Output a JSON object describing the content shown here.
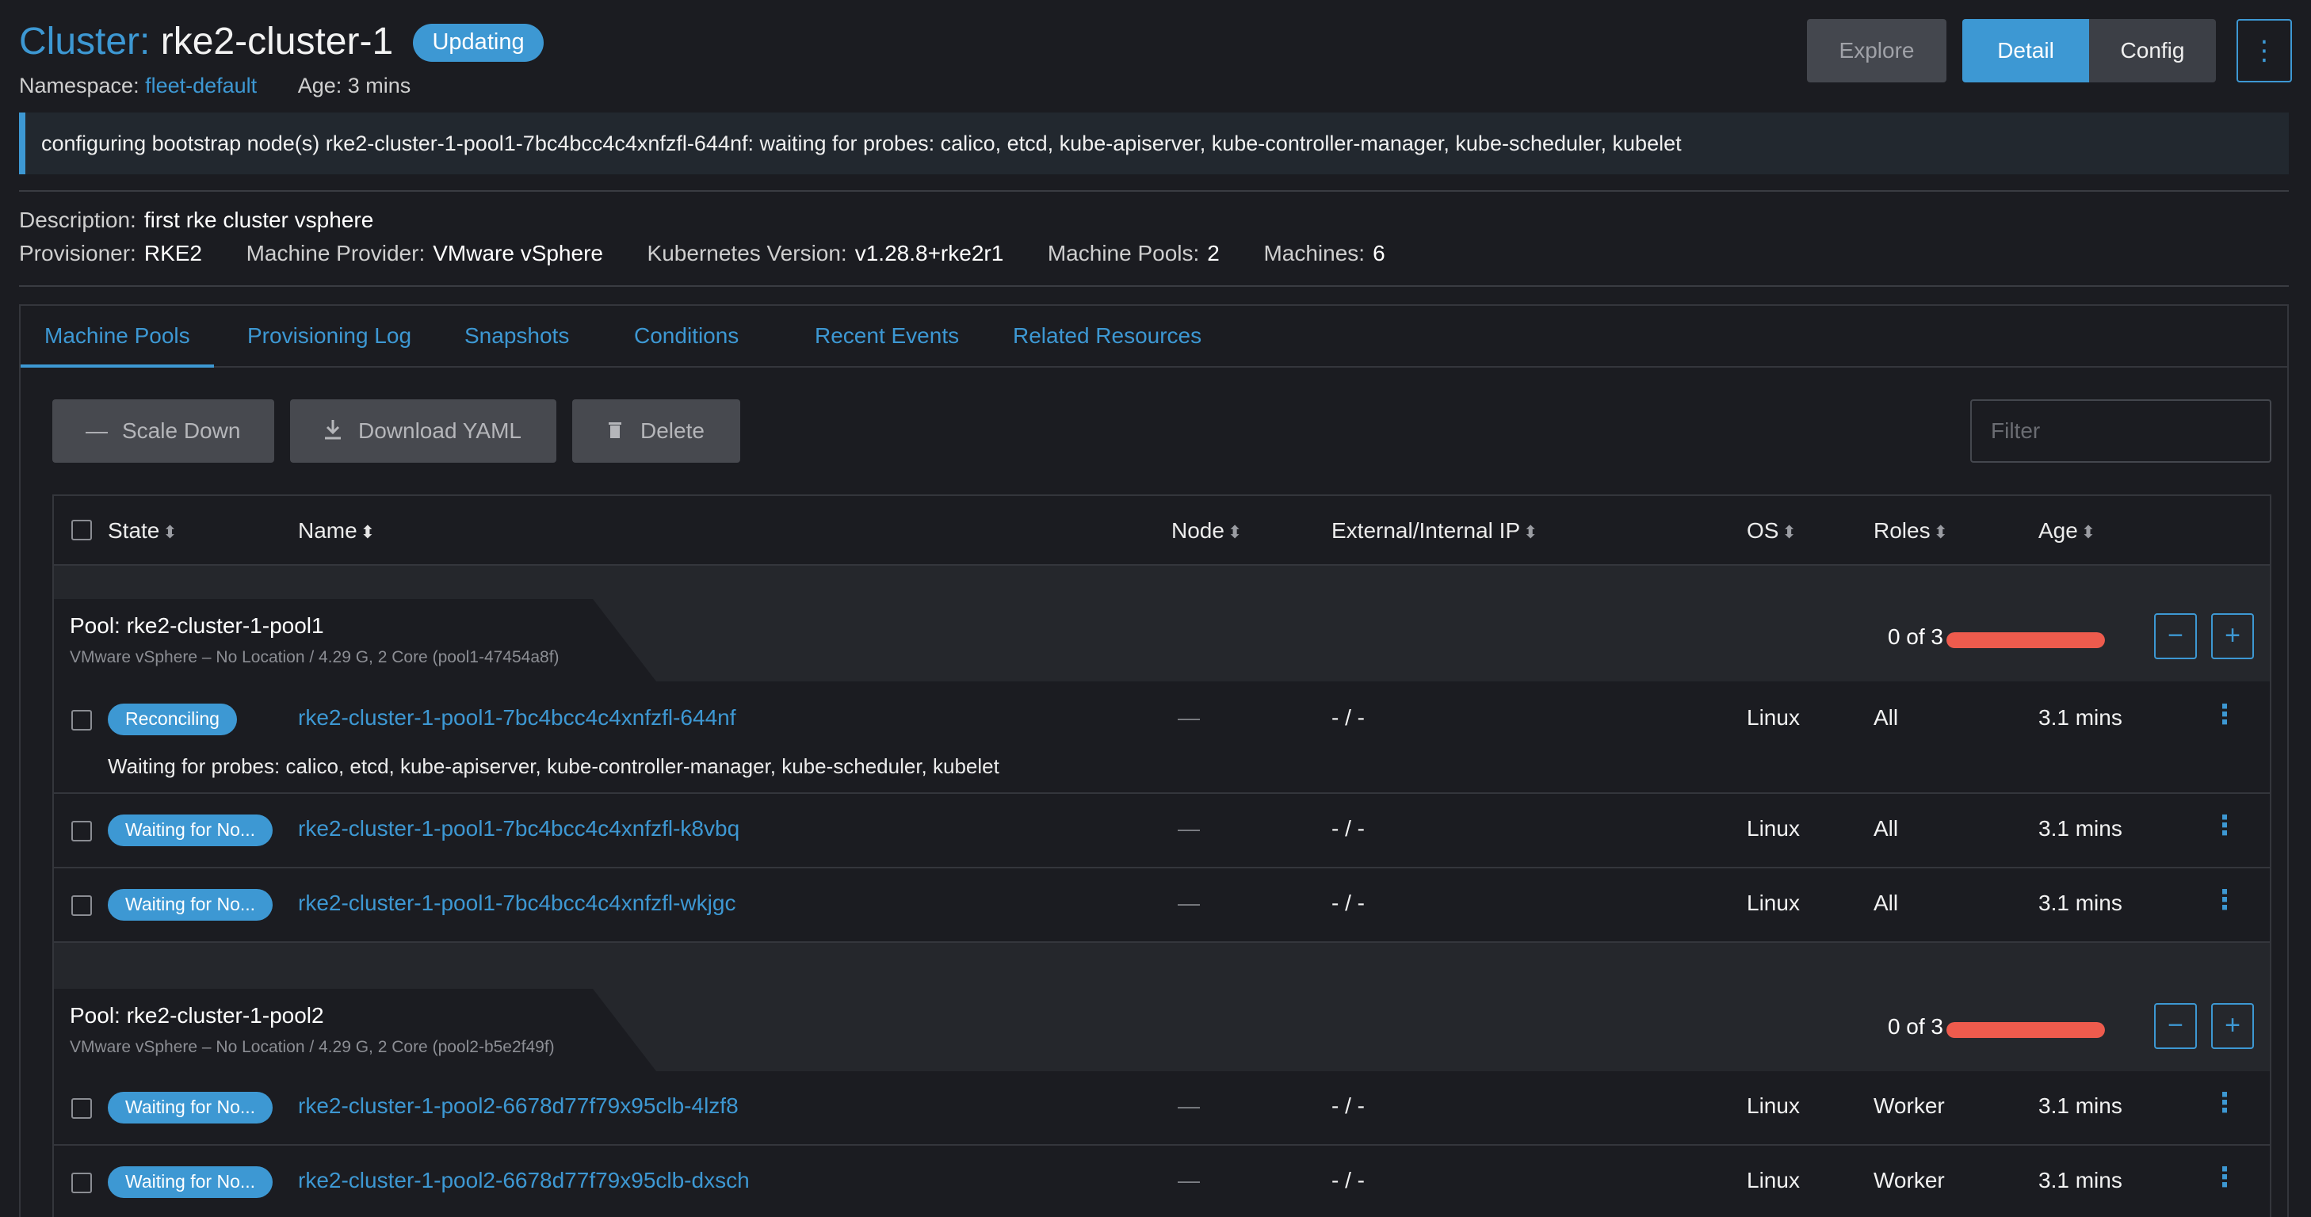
{
  "header": {
    "title_prefix": "Cluster:",
    "title_name": "rke2-cluster-1",
    "status_badge": "Updating",
    "namespace_label": "Namespace:",
    "namespace_value": "fleet-default",
    "age_label": "Age:",
    "age_value": "3 mins",
    "buttons": {
      "explore": "Explore",
      "detail": "Detail",
      "config": "Config",
      "more": "⋮"
    }
  },
  "banner": {
    "message": "configuring bootstrap node(s) rke2-cluster-1-pool1-7bc4bcc4c4xnfzfl-644nf: waiting for probes: calico, etcd, kube-apiserver, kube-controller-manager, kube-scheduler, kubelet"
  },
  "info": {
    "description_label": "Description:",
    "description_value": "first rke cluster vsphere",
    "provisioner_label": "Provisioner:",
    "provisioner_value": "RKE2",
    "machine_provider_label": "Machine Provider:",
    "machine_provider_value": "VMware vSphere",
    "k8s_version_label": "Kubernetes Version:",
    "k8s_version_value": "v1.28.8+rke2r1",
    "machine_pools_label": "Machine Pools:",
    "machine_pools_value": "2",
    "machines_label": "Machines:",
    "machines_value": "6"
  },
  "tabs": [
    "Machine Pools",
    "Provisioning Log",
    "Snapshots",
    "Conditions",
    "Recent Events",
    "Related Resources"
  ],
  "actions": {
    "scale_down": "Scale Down",
    "download_yaml": "Download YAML",
    "delete": "Delete",
    "filter_placeholder": "Filter"
  },
  "table": {
    "columns": {
      "state": "State",
      "name": "Name",
      "node": "Node",
      "ip": "External/Internal IP",
      "os": "OS",
      "roles": "Roles",
      "age": "Age"
    },
    "groups": [
      {
        "title": "Pool: rke2-cluster-1-pool1",
        "subtitle": "VMware vSphere – No Location / 4.29 G, 2 Core (pool1-47454a8f)",
        "count_text": "0 of 3",
        "progress_fraction": 0,
        "rows": [
          {
            "state": "Reconciling",
            "name": "rke2-cluster-1-pool1-7bc4bcc4c4xnfzfl-644nf",
            "node": "—",
            "ip": "- / -",
            "os": "Linux",
            "roles": "All",
            "age": "3.1 mins",
            "message": "Waiting for probes: calico, etcd, kube-apiserver, kube-controller-manager, kube-scheduler, kubelet"
          },
          {
            "state": "Waiting for No...",
            "name": "rke2-cluster-1-pool1-7bc4bcc4c4xnfzfl-k8vbq",
            "node": "—",
            "ip": "- / -",
            "os": "Linux",
            "roles": "All",
            "age": "3.1 mins"
          },
          {
            "state": "Waiting for No...",
            "name": "rke2-cluster-1-pool1-7bc4bcc4c4xnfzfl-wkjgc",
            "node": "—",
            "ip": "- / -",
            "os": "Linux",
            "roles": "All",
            "age": "3.1 mins"
          }
        ]
      },
      {
        "title": "Pool: rke2-cluster-1-pool2",
        "subtitle": "VMware vSphere – No Location / 4.29 G, 2 Core (pool2-b5e2f49f)",
        "count_text": "0 of 3",
        "progress_fraction": 0,
        "rows": [
          {
            "state": "Waiting for No...",
            "name": "rke2-cluster-1-pool2-6678d77f79x95clb-4lzf8",
            "node": "—",
            "ip": "- / -",
            "os": "Linux",
            "roles": "Worker",
            "age": "3.1 mins"
          },
          {
            "state": "Waiting for No...",
            "name": "rke2-cluster-1-pool2-6678d77f79x95clb-dxsch",
            "node": "—",
            "ip": "- / -",
            "os": "Linux",
            "roles": "Worker",
            "age": "3.1 mins"
          }
        ]
      }
    ]
  },
  "icons": {
    "sort": "sort-icon",
    "minus": "minus-icon",
    "download": "download-icon",
    "trash": "trash-icon",
    "kebab": "kebab-icon",
    "plus": "plus-icon"
  },
  "colors": {
    "accent": "#3d98d3",
    "progress": "#ee5b4d",
    "background": "#1b1c21"
  }
}
